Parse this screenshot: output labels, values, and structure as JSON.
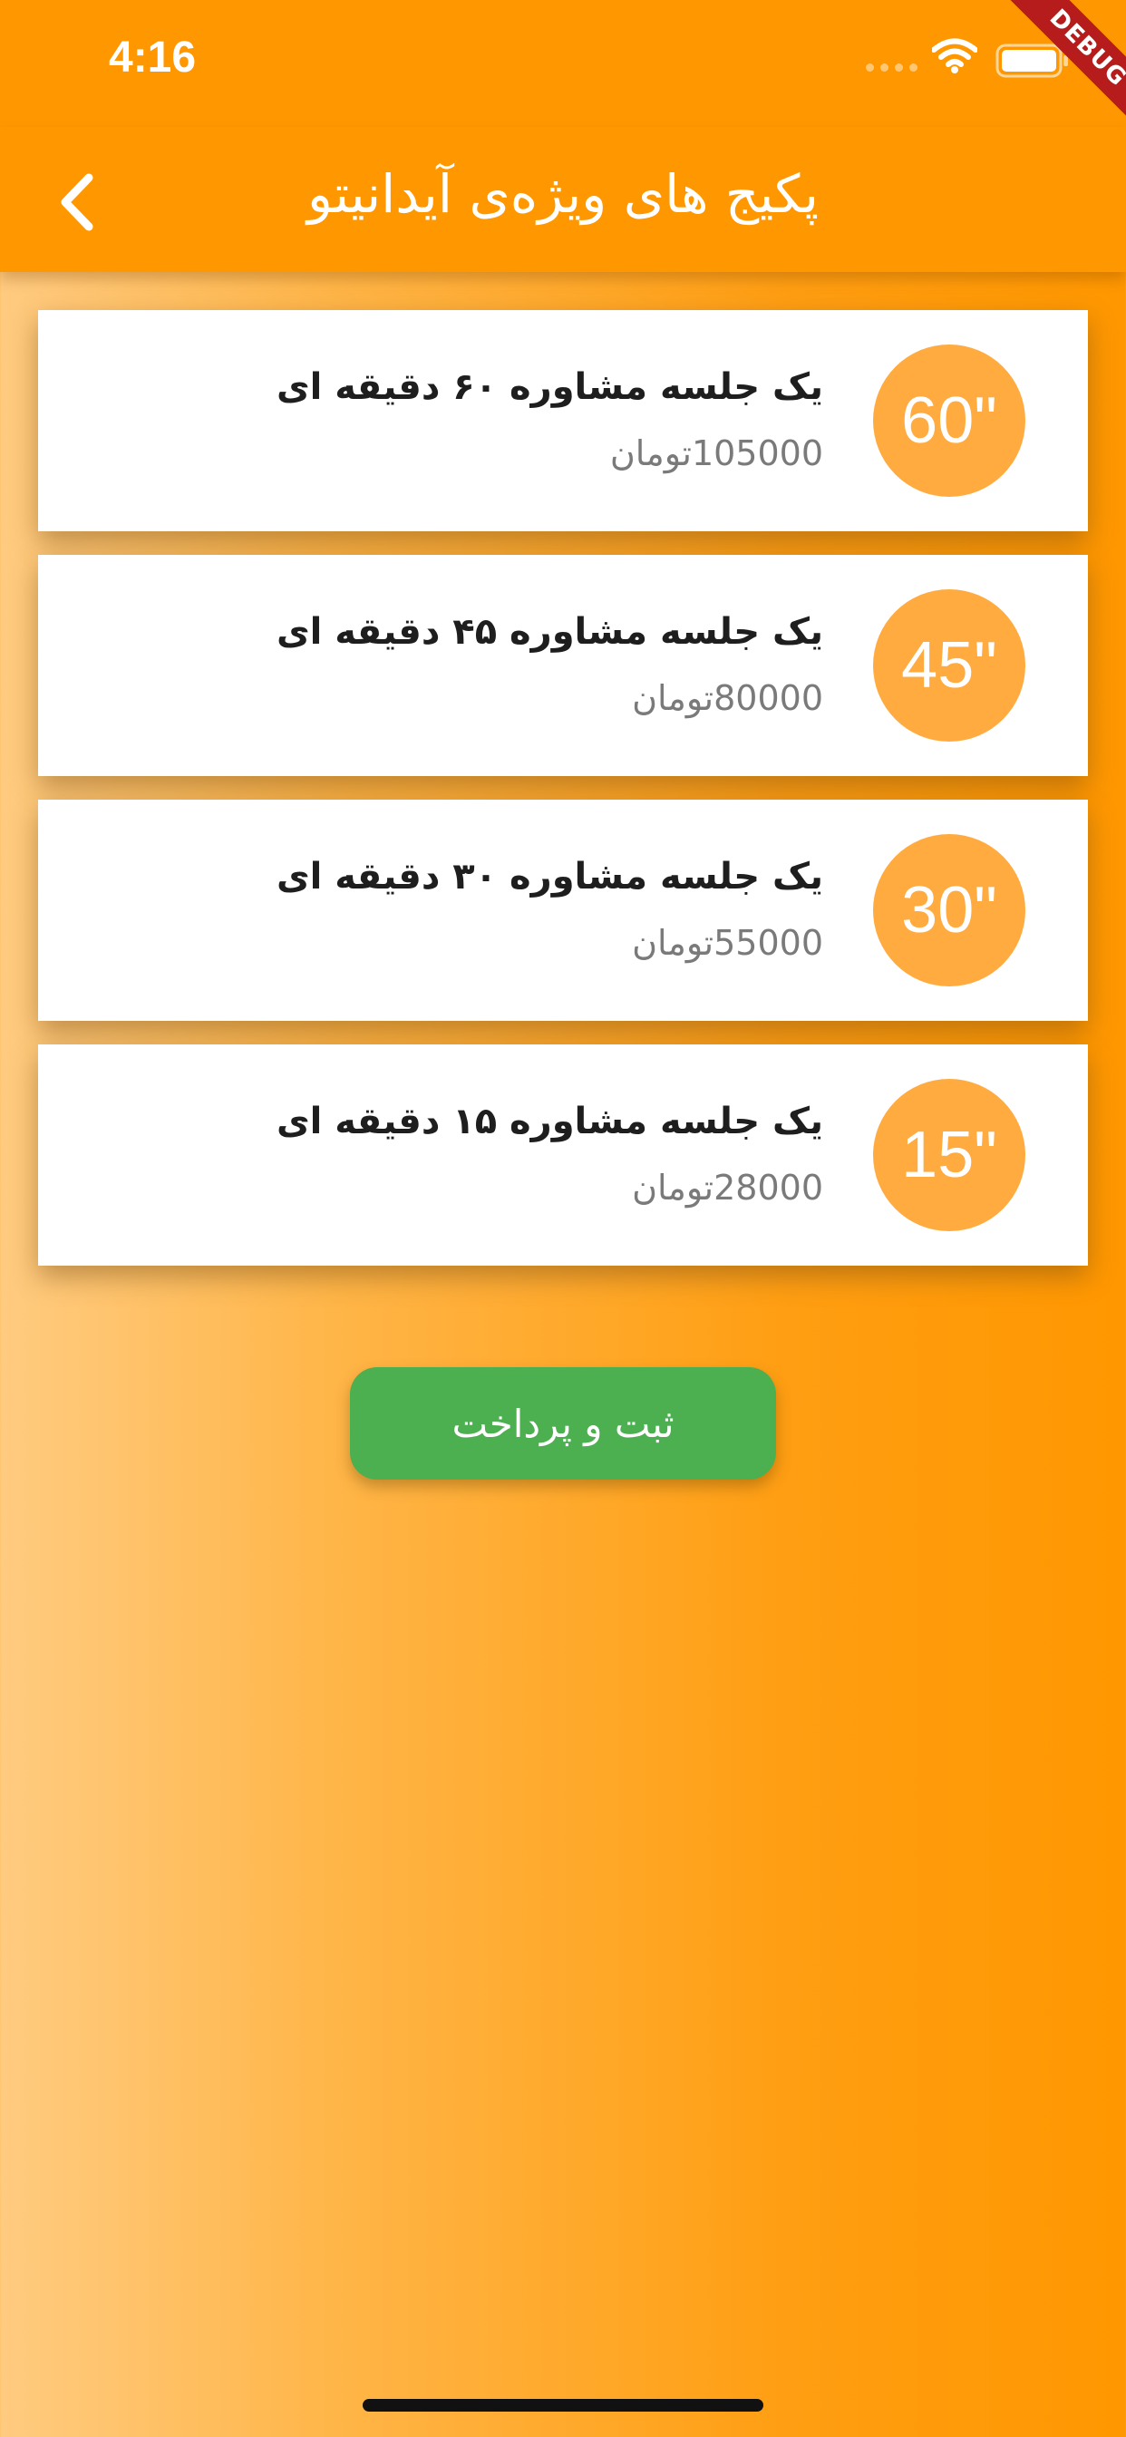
{
  "status_bar": {
    "time": "4:16",
    "debug_label": "DEBUG"
  },
  "app_bar": {
    "title": "پکیج های ویژه‌ی آیدانیتو",
    "back_icon": "chevron-left-icon"
  },
  "packages": [
    {
      "duration": "60\"",
      "title": "یک جلسه مشاوره ۶۰ دقیقه ای",
      "price": "105000تومان"
    },
    {
      "duration": "45\"",
      "title": "یک جلسه مشاوره ۴۵ دقیقه ای",
      "price": "80000تومان"
    },
    {
      "duration": "30\"",
      "title": "یک جلسه مشاوره ۳۰ دقیقه ای",
      "price": "55000تومان"
    },
    {
      "duration": "15\"",
      "title": "یک جلسه مشاوره ۱۵ دقیقه ای",
      "price": "28000تومان"
    }
  ],
  "pay_button": {
    "label": "ثبت و پرداخت"
  },
  "colors": {
    "primary": "#ff9800",
    "circle": "#ffab40",
    "button": "#4caf50",
    "debug": "#b71c1c"
  }
}
